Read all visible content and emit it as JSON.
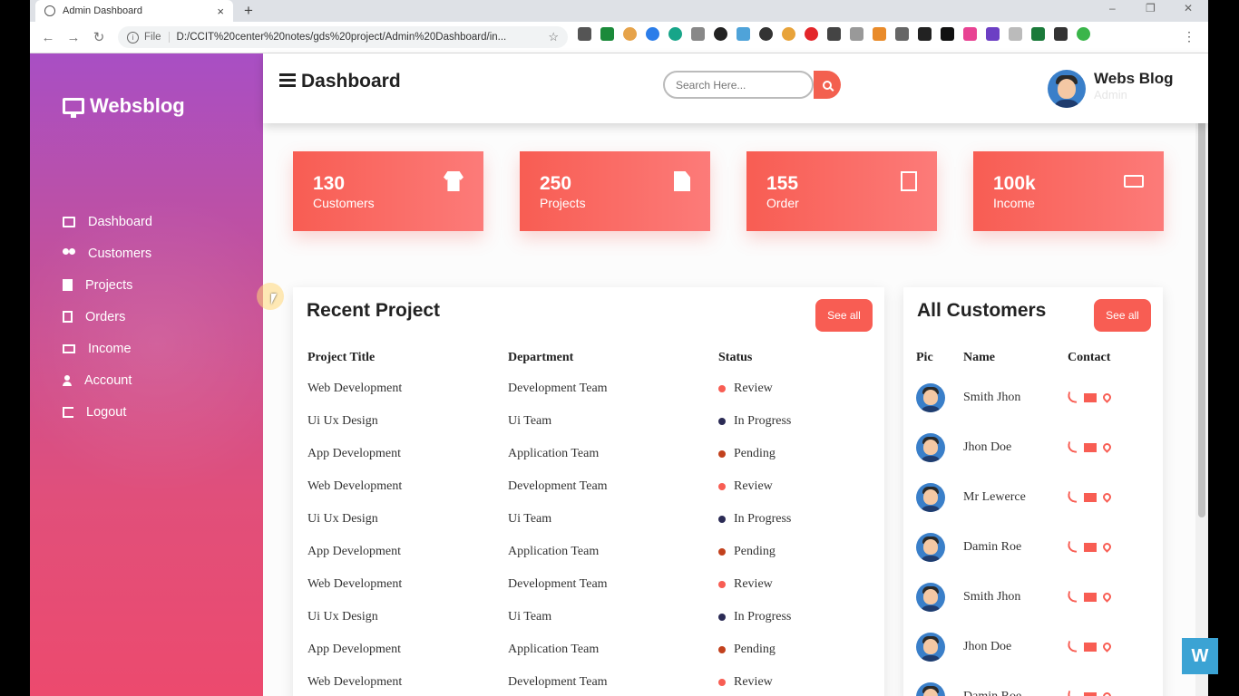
{
  "browser": {
    "tab_title": "Admin Dashboard",
    "tab_close": "×",
    "new_tab": "+",
    "url_prefix": "File",
    "url": "D:/CCIT%20center%20notes/gds%20project/Admin%20Dashboard/in...",
    "win_min": "–",
    "win_max": "❐",
    "win_close": "✕",
    "back": "←",
    "forward": "→",
    "reload": "↻",
    "star": "☆",
    "menu": "⋮"
  },
  "sidebar": {
    "brand": "Websblog",
    "items": [
      {
        "label": "Dashboard",
        "icon": "monitor-icon"
      },
      {
        "label": "Customers",
        "icon": "users-icon"
      },
      {
        "label": "Projects",
        "icon": "file-icon"
      },
      {
        "label": "Orders",
        "icon": "pdf-icon"
      },
      {
        "label": "Income",
        "icon": "money-icon"
      },
      {
        "label": "Account",
        "icon": "user-icon"
      },
      {
        "label": "Logout",
        "icon": "sign-out-icon"
      }
    ]
  },
  "header": {
    "title": "Dashboard",
    "search_placeholder": "Search Here...",
    "user_name": "Webs Blog",
    "user_role": "Admin"
  },
  "cards": [
    {
      "value": "130",
      "label": "Customers",
      "icon": "shirt-icon"
    },
    {
      "value": "250",
      "label": "Projects",
      "icon": "file-icon"
    },
    {
      "value": "155",
      "label": "Order",
      "icon": "pdf-icon"
    },
    {
      "value": "100k",
      "label": "Income",
      "icon": "money-icon"
    }
  ],
  "recent_project": {
    "title": "Recent Project",
    "see_all": "See all",
    "columns": [
      "Project Title",
      "Department",
      "Status"
    ],
    "rows": [
      [
        "Web Development",
        "Development Team",
        "Review"
      ],
      [
        "Ui Ux Design",
        "Ui Team",
        "In Progress"
      ],
      [
        "App Development",
        "Application Team",
        "Pending"
      ],
      [
        "Web Development",
        "Development Team",
        "Review"
      ],
      [
        "Ui Ux Design",
        "Ui Team",
        "In Progress"
      ],
      [
        "App Development",
        "Application Team",
        "Pending"
      ],
      [
        "Web Development",
        "Development Team",
        "Review"
      ],
      [
        "Ui Ux Design",
        "Ui Team",
        "In Progress"
      ],
      [
        "App Development",
        "Application Team",
        "Pending"
      ],
      [
        "Web Development",
        "Development Team",
        "Review"
      ]
    ],
    "status_colors": {
      "Review": "#f85d53",
      "In Progress": "#2b2b55",
      "Pending": "#c2411d"
    }
  },
  "all_customers": {
    "title": "All Customers",
    "see_all": "See all",
    "columns": [
      "Pic",
      "Name",
      "Contact"
    ],
    "rows": [
      "Smith Jhon",
      "Jhon Doe",
      "Mr Lewerce",
      "Damin Roe",
      "Smith Jhon",
      "Jhon Doe",
      "Damin Roe"
    ]
  },
  "overlay": {
    "logo": "W"
  },
  "colors": {
    "accent": "#f85d53",
    "sidebar_top": "#a84fc4",
    "sidebar_bottom": "#ec4a6e"
  }
}
